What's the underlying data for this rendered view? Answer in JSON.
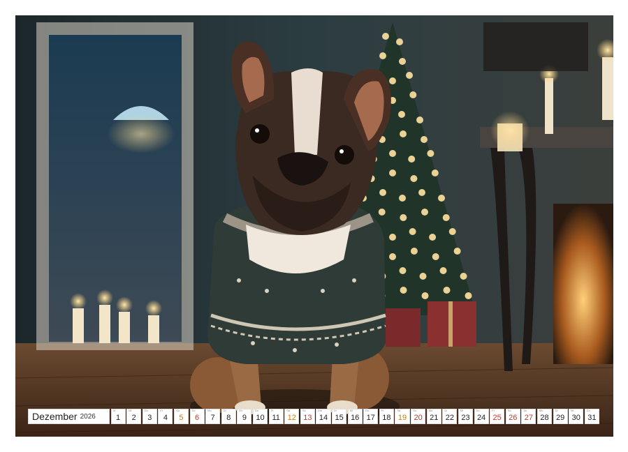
{
  "calendar": {
    "month": "Dezember",
    "year": "2026",
    "colors": {
      "weekday": "#222222",
      "saturday": "#d07a00",
      "sunday": "#c0392b",
      "holiday": "#c0392b"
    },
    "days": [
      {
        "n": "1",
        "wd": "Di",
        "type": "weekday"
      },
      {
        "n": "2",
        "wd": "Mi",
        "type": "weekday"
      },
      {
        "n": "3",
        "wd": "Do",
        "type": "weekday"
      },
      {
        "n": "4",
        "wd": "Fr",
        "type": "weekday"
      },
      {
        "n": "5",
        "wd": "Sa",
        "type": "sat"
      },
      {
        "n": "6",
        "wd": "So",
        "type": "sun"
      },
      {
        "n": "7",
        "wd": "Mo",
        "type": "weekday"
      },
      {
        "n": "8",
        "wd": "Di",
        "type": "weekday"
      },
      {
        "n": "9",
        "wd": "Mi",
        "type": "weekday"
      },
      {
        "n": "10",
        "wd": "Do",
        "type": "weekday"
      },
      {
        "n": "11",
        "wd": "Fr",
        "type": "weekday"
      },
      {
        "n": "12",
        "wd": "Sa",
        "type": "sat"
      },
      {
        "n": "13",
        "wd": "So",
        "type": "sun"
      },
      {
        "n": "14",
        "wd": "Mo",
        "type": "weekday"
      },
      {
        "n": "15",
        "wd": "Di",
        "type": "weekday"
      },
      {
        "n": "16",
        "wd": "Mi",
        "type": "weekday"
      },
      {
        "n": "17",
        "wd": "Do",
        "type": "weekday"
      },
      {
        "n": "18",
        "wd": "Fr",
        "type": "weekday"
      },
      {
        "n": "19",
        "wd": "Sa",
        "type": "sat"
      },
      {
        "n": "20",
        "wd": "So",
        "type": "sun"
      },
      {
        "n": "21",
        "wd": "Mo",
        "type": "weekday"
      },
      {
        "n": "22",
        "wd": "Di",
        "type": "weekday"
      },
      {
        "n": "23",
        "wd": "Mi",
        "type": "weekday"
      },
      {
        "n": "24",
        "wd": "Do",
        "type": "weekday"
      },
      {
        "n": "25",
        "wd": "Fr",
        "type": "hol"
      },
      {
        "n": "26",
        "wd": "Sa",
        "type": "hol"
      },
      {
        "n": "27",
        "wd": "So",
        "type": "sun"
      },
      {
        "n": "28",
        "wd": "Mo",
        "type": "weekday"
      },
      {
        "n": "29",
        "wd": "Di",
        "type": "weekday"
      },
      {
        "n": "30",
        "wd": "Mi",
        "type": "weekday"
      },
      {
        "n": "31",
        "wd": "Do",
        "type": "weekday"
      }
    ]
  },
  "photo": {
    "subject": "french-bulldog-in-christmas-sweater",
    "palette": {
      "wall": "#2a3b40",
      "floor": "#5a3b24",
      "glow": "#ffd27a",
      "sweater": "#2f3b36"
    }
  }
}
